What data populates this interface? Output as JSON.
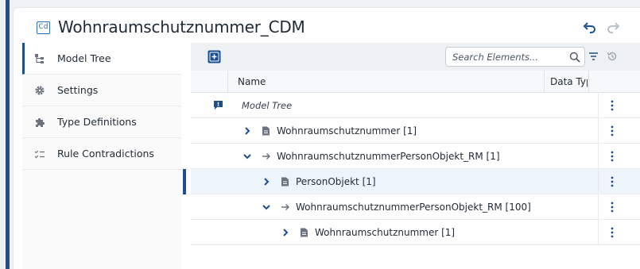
{
  "header": {
    "badge": "Cd",
    "title": "Wohnraumschutznummer_CDM"
  },
  "sidebar": {
    "items": [
      {
        "label": "Model Tree",
        "icon": "tree-icon",
        "active": true
      },
      {
        "label": "Settings",
        "icon": "gear-icon",
        "active": false
      },
      {
        "label": "Type Definitions",
        "icon": "puzzle-icon",
        "active": false
      },
      {
        "label": "Rule Contradictions",
        "icon": "check-list-icon",
        "active": false
      }
    ]
  },
  "toolbar": {
    "search_placeholder": "Search Elements..."
  },
  "table": {
    "columns": [
      "Name",
      "Data Type"
    ],
    "rows": [
      {
        "label": "Model Tree",
        "kind": "root"
      },
      {
        "label": "Wohnraumschutznummer [1]",
        "kind": "doc",
        "expanded": false
      },
      {
        "label": "WohnraumschutznummerPersonObjekt_RM [1]",
        "kind": "relation",
        "expanded": true
      },
      {
        "label": "PersonObjekt [1]",
        "kind": "doc",
        "expanded": false,
        "selected": true
      },
      {
        "label": "WohnraumschutznummerPersonObjekt_RM [100]",
        "kind": "relation",
        "expanded": true
      },
      {
        "label": "Wohnraumschutznummer [1]",
        "kind": "doc",
        "expanded": false
      }
    ]
  },
  "colors": {
    "accent": "#1b4f8f",
    "link": "#2a6fb5"
  }
}
